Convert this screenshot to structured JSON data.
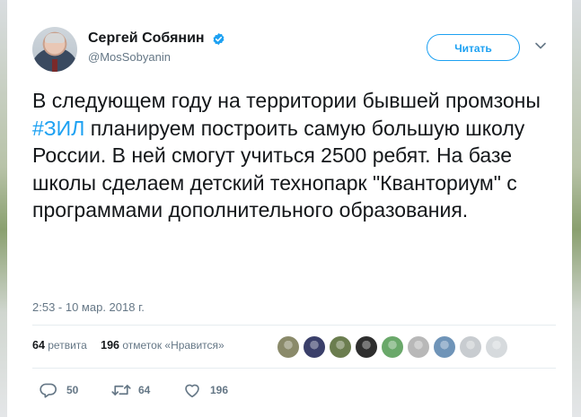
{
  "author": {
    "display_name": "Сергей Собянин",
    "username": "@MosSobyanin",
    "verified_icon": "verified-badge-icon"
  },
  "header": {
    "follow_button_label": "Читать"
  },
  "tweet": {
    "text_before": "В следующем году на территории бывшей промзоны ",
    "hashtag": "#ЗИЛ",
    "text_after": " планируем построить самую большую школу России. В ней смогут учиться 2500 ребят. На базе школы сделаем детский технопарк \"Кванториум\" с программами дополнительного образования.",
    "timestamp": "2:53 - 10 мар. 2018 г."
  },
  "stats": {
    "retweets_count": "64",
    "retweets_label": "ретвита",
    "likes_count": "196",
    "likes_label": "отметок «Нравится»"
  },
  "likers_colors": [
    "#8a8a6a",
    "#3a3f6a",
    "#6b7d4f",
    "#2e2e2e",
    "#6aa86a",
    "#b8b8b8",
    "#6f94b8",
    "#c8ccd0",
    "#d6dadd"
  ],
  "actions": {
    "reply_count": "50",
    "retweet_count": "64",
    "like_count": "196"
  },
  "colors": {
    "accent": "#1da1f2",
    "muted": "#657786",
    "text": "#14171a"
  }
}
